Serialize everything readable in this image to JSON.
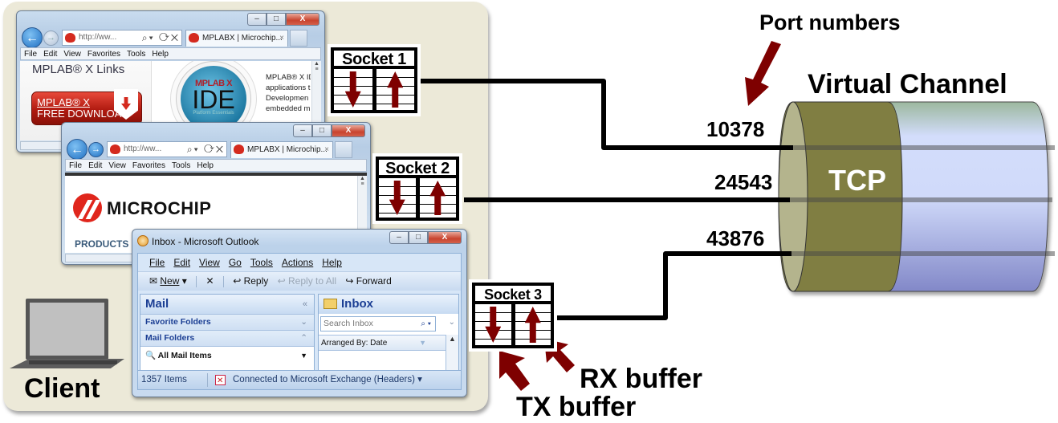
{
  "diagram": {
    "client_label": "Client",
    "port_numbers_label": "Port numbers",
    "virtual_channel_label": "Virtual Channel",
    "tcp_label": "TCP",
    "rx_buffer_label": "RX buffer",
    "tx_buffer_label": "TX buffer",
    "sockets": [
      {
        "label": "Socket 1",
        "port": "10378"
      },
      {
        "label": "Socket 2",
        "port": "24543"
      },
      {
        "label": "Socket 3",
        "port": "43876"
      }
    ],
    "colors": {
      "client_panel": "#ece9d8",
      "arrow_red": "#7e0000",
      "tcp_band": "#7f7d42",
      "tcp_end_cap": "#b4b48c",
      "channel_blue": "#d3ddfb"
    }
  },
  "browser1": {
    "address": "http://ww...",
    "tab_title": "MPLABX | Microchip...",
    "menu": [
      "File",
      "Edit",
      "View",
      "Favorites",
      "Tools",
      "Help"
    ],
    "links_title": "MPLAB® X Links",
    "download_line1": "MPLAB® X",
    "download_line2": "FREE DOWNLOAD",
    "ide_logo_top": "MPLAB X",
    "ide_logo_mid": "IDE",
    "ide_logo_bottom": "Platform Essentials",
    "body_text": [
      "MPLAB® X IDE",
      "applications t",
      "Developmen",
      "embedded m"
    ]
  },
  "browser2": {
    "address": "http://ww...",
    "tab_title": "MPLABX | Microchip...",
    "menu": [
      "File",
      "Edit",
      "View",
      "Favorites",
      "Tools",
      "Help"
    ],
    "brand": "MICROCHIP",
    "nav_item": "PRODUCTS"
  },
  "outlook": {
    "title": "Inbox - Microsoft Outlook",
    "menu": [
      "File",
      "Edit",
      "View",
      "Go",
      "Tools",
      "Actions",
      "Help"
    ],
    "toolbar": {
      "new": "New",
      "delete": "✕",
      "reply": "Reply",
      "reply_all": "Reply to All",
      "forward": "Forward"
    },
    "mail_header": "Mail",
    "favorite_folders": "Favorite Folders",
    "mail_folders": "Mail Folders",
    "all_mail_items": "All Mail Items",
    "inbox_header": "Inbox",
    "search_placeholder": "Search Inbox",
    "arranged_by": "Arranged By: Date",
    "status_items": "1357 Items",
    "status_connection": "Connected to Microsoft Exchange (Headers)"
  }
}
